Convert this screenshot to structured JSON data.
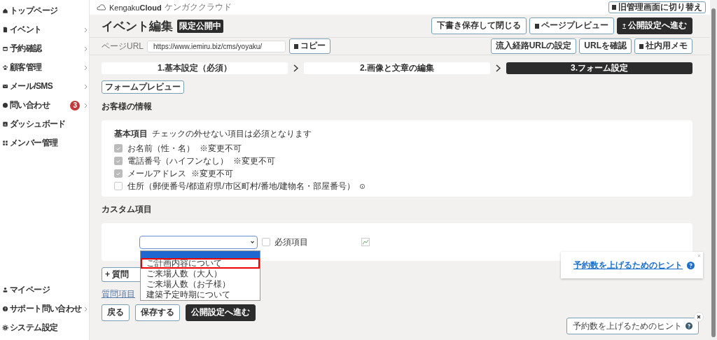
{
  "header": {
    "logo": "Kengaku**Cloud**",
    "logo_sub": "ケンガククラウド",
    "switch_button": "旧管理画面に切り替え"
  },
  "sidebar": {
    "items": [
      {
        "label": "トップページ",
        "has_submenu": false
      },
      {
        "label": "イベント",
        "has_submenu": true
      },
      {
        "label": "予約確認",
        "has_submenu": true
      },
      {
        "label": "顧客管理",
        "has_submenu": true
      },
      {
        "label": "メール/SMS",
        "has_submenu": true
      },
      {
        "label": "問い合わせ",
        "has_submenu": true,
        "badge": "3"
      },
      {
        "label": "ダッシュボード",
        "has_submenu": false
      },
      {
        "label": "メンバー管理",
        "has_submenu": false
      }
    ],
    "bottom_items": [
      {
        "label": "マイページ",
        "has_submenu": false
      },
      {
        "label": "サポート問い合わせ",
        "has_submenu": true
      },
      {
        "label": "システム設定",
        "has_submenu": false
      }
    ]
  },
  "page": {
    "title": "イベント編集",
    "status": "限定公開中",
    "actions": [
      {
        "label": "下書き保存して閉じる",
        "primary": false
      },
      {
        "label": "ページプレビュー",
        "primary": false
      },
      {
        "label": "公開設定へ進む",
        "primary": true
      }
    ]
  },
  "url_bar": {
    "label": "ページURL",
    "value": "https://www.iemiru.biz/cms/yoyaku/",
    "copy_button": "コピー",
    "buttons": [
      "流入経路URLの設定",
      "URLを確認",
      "社内用メモ"
    ]
  },
  "steps": [
    {
      "label": "1.基本設定（必須）",
      "selected": false
    },
    {
      "label": "2.画像と文章の編集",
      "selected": false
    },
    {
      "label": "3.フォーム設定",
      "selected": true
    }
  ],
  "form_preview": "フォームプレビュー",
  "customer_info": {
    "heading": "お客様の情報",
    "group_title": "基本項目",
    "group_note": "チェックの外せない項目は必須となります",
    "fields": [
      {
        "label": "お名前（性・名）",
        "note": "※変更不可",
        "checked": true,
        "disabled": true
      },
      {
        "label": "電話番号（ハイフンなし）",
        "note": "※変更不可",
        "checked": true,
        "disabled": true
      },
      {
        "label": "メールアドレス",
        "note": "※変更不可",
        "checked": true,
        "disabled": true
      },
      {
        "label": "住所（郵便番号/都道府県/市区町村/番地/建物名・部屋番号）",
        "checked": false,
        "disabled": false,
        "info": true
      }
    ]
  },
  "custom": {
    "heading": "カスタム項目",
    "dropdown_expanded": true,
    "options": [
      {
        "label": "ご計画内容について",
        "marked": true
      },
      {
        "label": "ご来場人数（大人）",
        "marked": false
      },
      {
        "label": "ご来場人数（お子様）",
        "marked": false
      },
      {
        "label": "建築予定時期について",
        "marked": false
      }
    ],
    "required": {
      "label": "必須項目",
      "checked": false
    },
    "add_button": "+ 質問",
    "link": "質問項目"
  },
  "footer_buttons": [
    {
      "label": "戻る",
      "primary": false
    },
    {
      "label": "保存する",
      "primary": false
    },
    {
      "label": "公開設定へ進む",
      "primary": true
    }
  ],
  "hints": [
    {
      "kind": "card",
      "label": "予約数を上げるためのヒント"
    },
    {
      "kind": "pill",
      "label": "予約数を上げるためのヒント"
    }
  ]
}
